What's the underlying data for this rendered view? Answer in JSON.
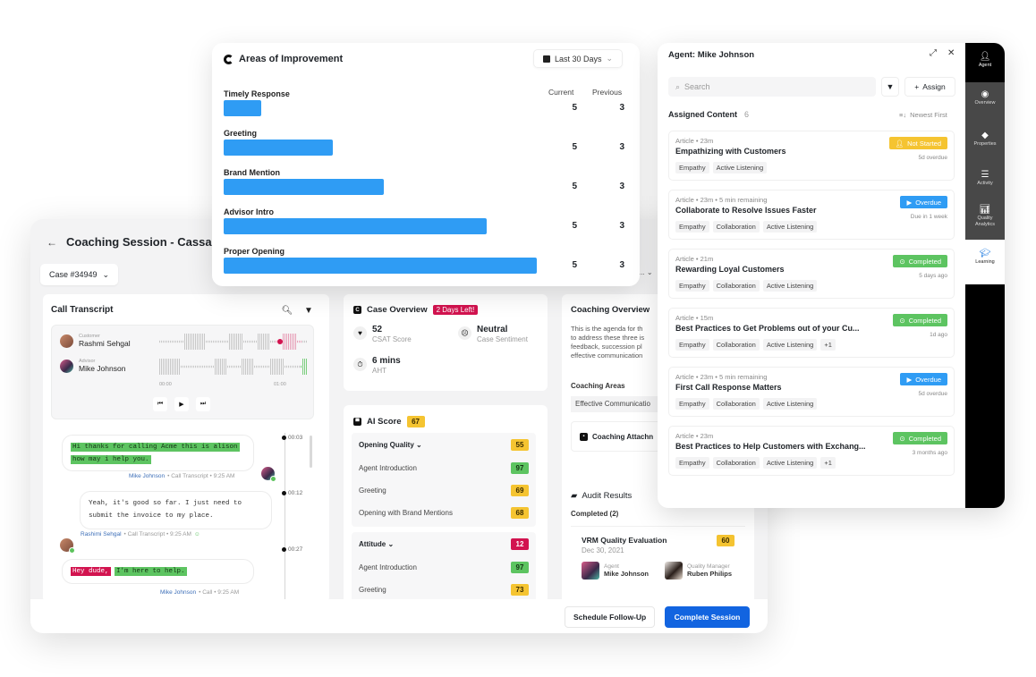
{
  "session": {
    "title": "Coaching Session - Cassand",
    "back_icon": "arrow-left-icon",
    "case_select": "Case #34949",
    "hidden_dropdown_text": "...",
    "transcript": {
      "title": "Call Transcript",
      "player": {
        "customer_role": "Customer",
        "customer_name": "Rashmi Sehgal",
        "advisor_role": "Advisor",
        "advisor_name": "Mike Johnson",
        "time_start": "00:00",
        "time_end": "01:00"
      },
      "messages": [
        {
          "segments": [
            {
              "text": "Hi thanks for calling Acme this is alison",
              "hl": "g"
            },
            {
              "text": "how may i help you.",
              "hl": "g"
            }
          ],
          "author": "Mike Johnson",
          "meta": "• Call Transcript • 9:25 AM",
          "timestamp": "00:03"
        },
        {
          "segments": [
            {
              "text": "Yeah, it's good so far. I just need to",
              "hl": ""
            },
            {
              "text": "submit the invoice to my place.",
              "hl": ""
            }
          ],
          "author": "Rashimi Sehgal",
          "meta": "• Call Transcript • 9:25 AM",
          "timestamp": "00:12"
        },
        {
          "segments": [
            {
              "text": "Hey dude,",
              "hl": "r"
            },
            {
              "text": "I'm here to help.",
              "hl": "g"
            }
          ],
          "author": "Mike Johnson",
          "meta": "• Call • 9:25 AM",
          "timestamp": "00:27"
        }
      ]
    },
    "case_overview": {
      "title": "Case Overview",
      "badge": "2 Days Left!",
      "stats": [
        {
          "value": "52",
          "label": "CSAT Score",
          "icon": "heart-icon"
        },
        {
          "value": "Neutral",
          "label": "Case Sentiment",
          "icon": "neutral-face-icon"
        },
        {
          "value": "6 mins",
          "label": "AHT",
          "icon": "stopwatch-icon"
        }
      ]
    },
    "ai_score": {
      "title": "AI Score",
      "score": "67",
      "groups": [
        {
          "name": "Opening Quality",
          "score": "55",
          "level": "y",
          "items": [
            {
              "name": "Agent Introduction",
              "score": "97",
              "level": "g"
            },
            {
              "name": "Greeting",
              "score": "69",
              "level": "y"
            },
            {
              "name": "Opening with Brand Mentions",
              "score": "68",
              "level": "y"
            }
          ]
        },
        {
          "name": "Attitude",
          "score": "12",
          "level": "r",
          "items": [
            {
              "name": "Agent Introduction",
              "score": "97",
              "level": "g"
            },
            {
              "name": "Greeting",
              "score": "73",
              "level": "y"
            }
          ]
        }
      ]
    },
    "coaching_overview": {
      "title": "Coaching Overview",
      "text_lines": [
        "This is the agenda for th",
        "to address these three is",
        "feedback, succession pl",
        "effective communication"
      ],
      "areas_label": "Coaching Areas",
      "area_chip": "Effective Communicatio",
      "attachment_label": "Coaching Attachn"
    },
    "audit": {
      "title": "Audit Results",
      "completed": "Completed (2)",
      "card": {
        "title": "VRM Quality Evaluation",
        "date": "Dec 30, 2021",
        "score": "60",
        "agent_role": "Agent",
        "agent_name": "Mike Johnson",
        "qm_role": "Quality Manager",
        "qm_name": "Ruben Philips"
      }
    },
    "footer": {
      "schedule": "Schedule Follow-Up",
      "complete": "Complete Session"
    }
  },
  "areas": {
    "title": "Areas of Improvement",
    "date_range": "Last 30 Days",
    "col_current": "Current",
    "col_previous": "Previous"
  },
  "chart_data": {
    "type": "bar",
    "orientation": "horizontal",
    "title": "Areas of Improvement",
    "categories": [
      "Timely Response",
      "Greeting",
      "Brand Mention",
      "Advisor Intro",
      "Proper Opening"
    ],
    "relative_bar_length": [
      0.12,
      0.35,
      0.51,
      0.84,
      1.0
    ],
    "current": [
      5,
      5,
      5,
      5,
      5
    ],
    "previous": [
      3,
      3,
      3,
      3,
      3
    ],
    "color": "#2f9cf4"
  },
  "agent_panel": {
    "title": "Agent: Mike Johnson",
    "search_placeholder": "Search",
    "assign": "Assign",
    "assigned_label": "Assigned Content",
    "assigned_count": "6",
    "sort": "Newest First",
    "items": [
      {
        "meta": "Article • 23m",
        "title": "Empathizing with Customers",
        "tags": [
          "Empathy",
          "Active Listening"
        ],
        "status": "Not Started",
        "status_type": "ns",
        "sub": "5d overdue"
      },
      {
        "meta": "Article • 23m • 5 min remaining",
        "title": "Collaborate to Resolve Issues Faster",
        "tags": [
          "Empathy",
          "Collaboration",
          "Active Listening"
        ],
        "status": "Overdue",
        "status_type": "ov",
        "sub": "Due in 1 week"
      },
      {
        "meta": "Article • 21m",
        "title": "Rewarding Loyal Customers",
        "tags": [
          "Empathy",
          "Collaboration",
          "Active Listening"
        ],
        "status": "Completed",
        "status_type": "co",
        "sub": "5 days ago"
      },
      {
        "meta": "Article • 15m",
        "title": "Best Practices to Get Problems out of your Cu...",
        "tags": [
          "Empathy",
          "Collaboration",
          "Active Listening",
          "+1"
        ],
        "status": "Completed",
        "status_type": "co",
        "sub": "1d ago"
      },
      {
        "meta": "Article • 23m • 5 min remaining",
        "title": "First Call Response Matters",
        "tags": [
          "Empathy",
          "Collaboration",
          "Active Listening"
        ],
        "status": "Overdue",
        "status_type": "ov",
        "sub": "5d overdue"
      },
      {
        "meta": "Article • 23m",
        "title": "Best Practices to Help Customers with Exchang...",
        "tags": [
          "Empathy",
          "Collaboration",
          "Active Listening",
          "+1"
        ],
        "status": "Completed",
        "status_type": "co",
        "sub": "3 months ago"
      }
    ],
    "rail": [
      {
        "label": "Agent",
        "icon": "agent-icon"
      },
      {
        "label": "Overview",
        "icon": "eye-icon"
      },
      {
        "label": "Properties",
        "icon": "tag-icon"
      },
      {
        "label": "Activity",
        "icon": "activity-icon"
      },
      {
        "label": "Quality Analytics",
        "icon": "analytics-icon"
      },
      {
        "label": "Learning",
        "icon": "graduation-cap-icon"
      }
    ]
  },
  "colors": {
    "accent_blue": "#1264e0",
    "bar_blue": "#2f9cf4",
    "green": "#5dc461",
    "yellow": "#f5c431",
    "red": "#d2134f"
  }
}
